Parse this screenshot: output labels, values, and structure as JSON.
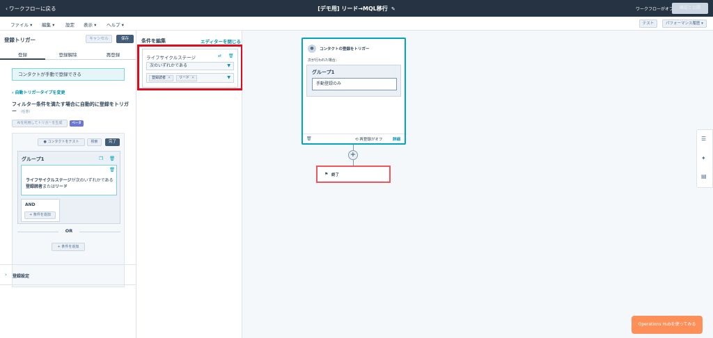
{
  "topbar": {
    "back_label": "ワークフローに戻る",
    "title": "[デモ用] リード→MQL移行",
    "workflow_status": "ワークフローがオフ",
    "review_button": "確認と公開"
  },
  "menubar": {
    "file": "ファイル",
    "edit": "編集",
    "settings": "設定",
    "view": "表示",
    "help": "ヘルプ",
    "test_button": "テスト",
    "performance_button": "パフォーマンス履歴"
  },
  "left_panel": {
    "title": "登録トリガー",
    "cancel_button": "キャンセル",
    "save_button": "保存",
    "tabs": [
      "登録",
      "登録解除",
      "再登録"
    ],
    "info_text": "コンタクトが手動で登録できる",
    "change_link": "‹ 自動トリガータイプを変更",
    "filter_title": "フィルター条件を満たす場合に自動的に登録をトリガー",
    "filter_optional": "（任意）",
    "ai_button": "AIを利用してトリガーを生成",
    "beta_badge": "ベータ",
    "test_contact_button": "コンタクトをテスト",
    "search_button": "検索",
    "done_button": "完了",
    "group_title": "グループ1",
    "condition_line1": "ライフサイクルステージが次のいずれかである",
    "condition_line2": "登録読者またはリード",
    "condition_strong1": "ライフサイクルステージ",
    "condition_strong2": "登録読者",
    "condition_strong3": "リード",
    "condition_mid": "が次のいずれかである",
    "condition_or": "または",
    "and_label": "AND",
    "add_condition": "条件を追加",
    "or_label": "OR",
    "add_condition2": "条件を追加",
    "enrollment_settings": "登録設定"
  },
  "middle_panel": {
    "title": "条件を編集",
    "close_editor": "エディターを閉じる",
    "property_title": "ライフサイクルステージ",
    "operator": "次のいずれかである",
    "tags": [
      "登録読者",
      "リード"
    ]
  },
  "canvas": {
    "trigger_title": "コンタクトの登録をトリガー",
    "trigger_sub": "次が行われた場合：",
    "group_title": "グループ1",
    "manual_only": "手動登録のみ",
    "reenroll_off": "再登録がオフ",
    "details": "詳細",
    "end_label": "終了"
  },
  "ops_hub_button": "Operations Hubを使ってみる"
}
